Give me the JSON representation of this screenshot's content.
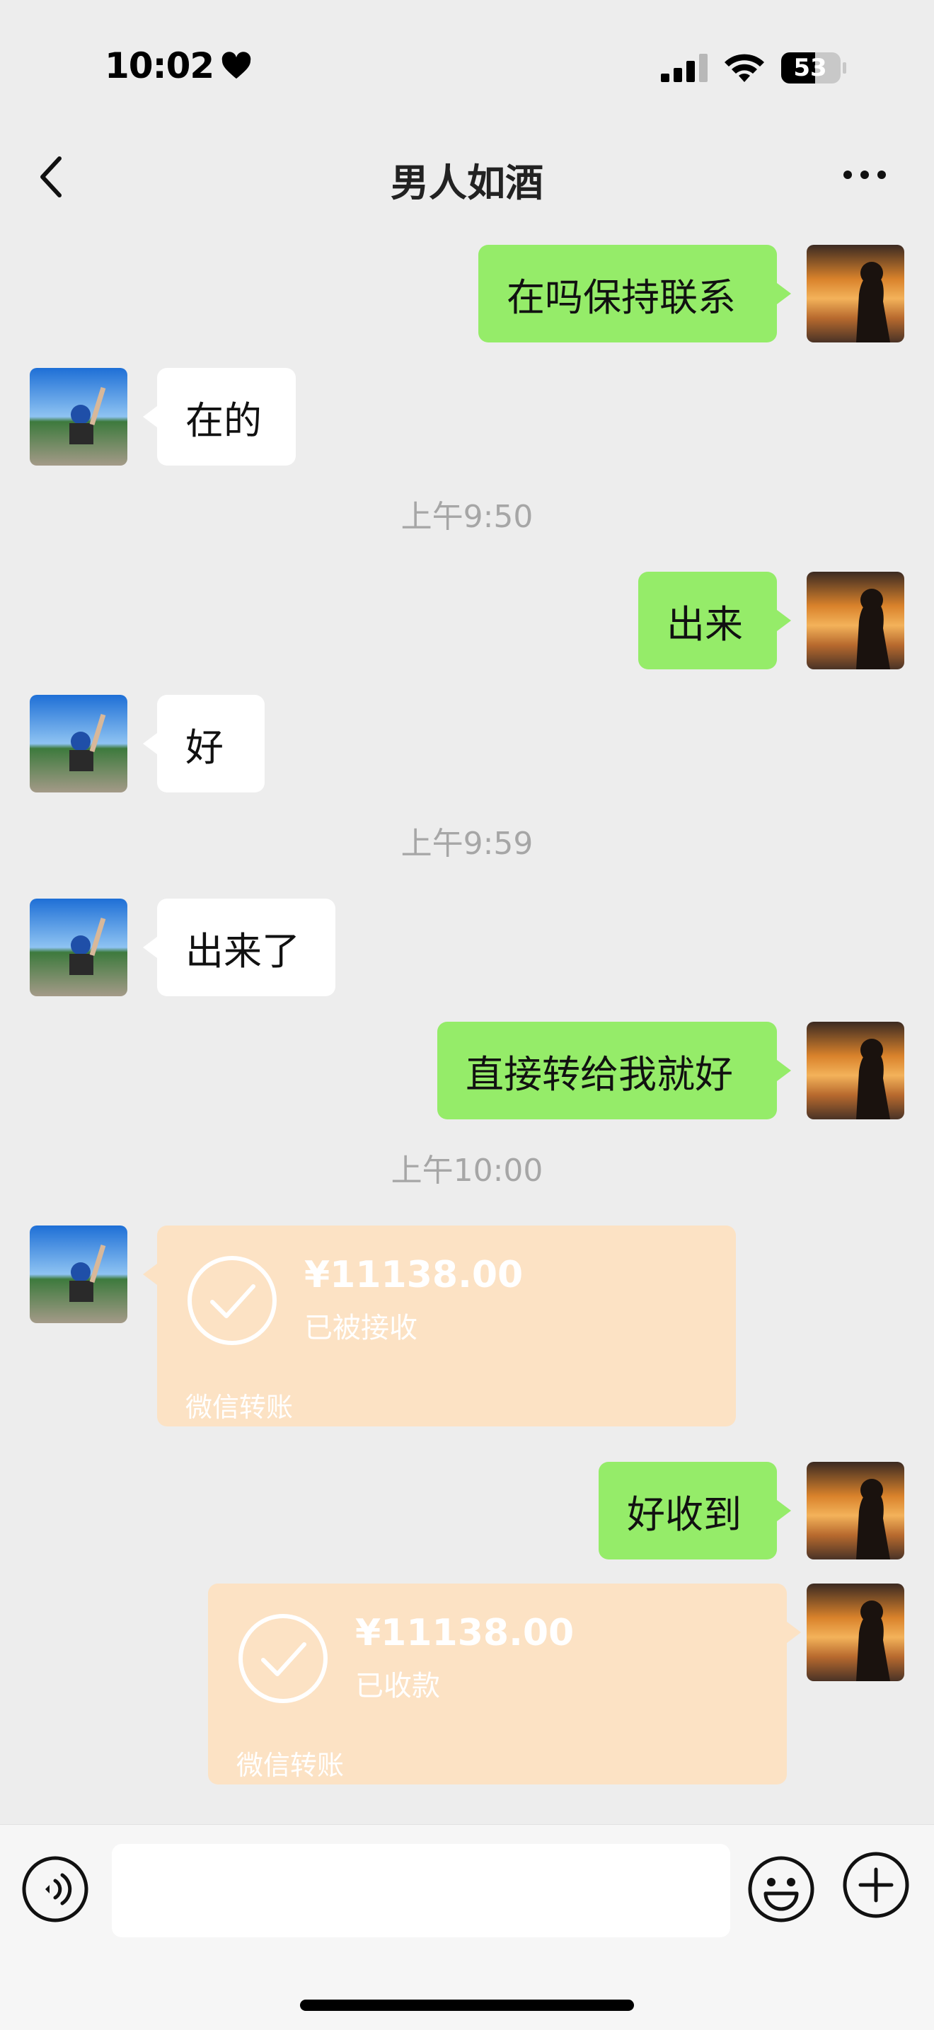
{
  "status": {
    "time": "10:02",
    "battery": "53"
  },
  "nav": {
    "title": "男人如酒",
    "back_icon": "chevron-left-icon",
    "more_icon": "more-dots-icon"
  },
  "messages": [
    {
      "side": "right",
      "text": "在吗保持联系"
    },
    {
      "side": "left",
      "text": "在的"
    },
    {
      "time": "上午9:50"
    },
    {
      "side": "right",
      "text": "出来"
    },
    {
      "side": "left",
      "text": "好"
    },
    {
      "time": "上午9:59"
    },
    {
      "side": "left",
      "text": "出来了"
    },
    {
      "side": "right",
      "text": "直接转给我就好"
    },
    {
      "time": "上午10:00"
    },
    {
      "side": "left",
      "type": "transfer",
      "amount": "¥11138.00",
      "status": "已被接收",
      "label": "微信转账"
    },
    {
      "side": "right",
      "text": "好收到"
    },
    {
      "side": "right",
      "type": "transfer",
      "amount": "¥11138.00",
      "status": "已收款",
      "label": "微信转账"
    }
  ],
  "colors": {
    "right_bubble": "#95ec69",
    "left_bubble": "#ffffff",
    "transfer_bg": "#fce2c4",
    "background": "#ededed"
  },
  "input": {
    "value": ""
  }
}
